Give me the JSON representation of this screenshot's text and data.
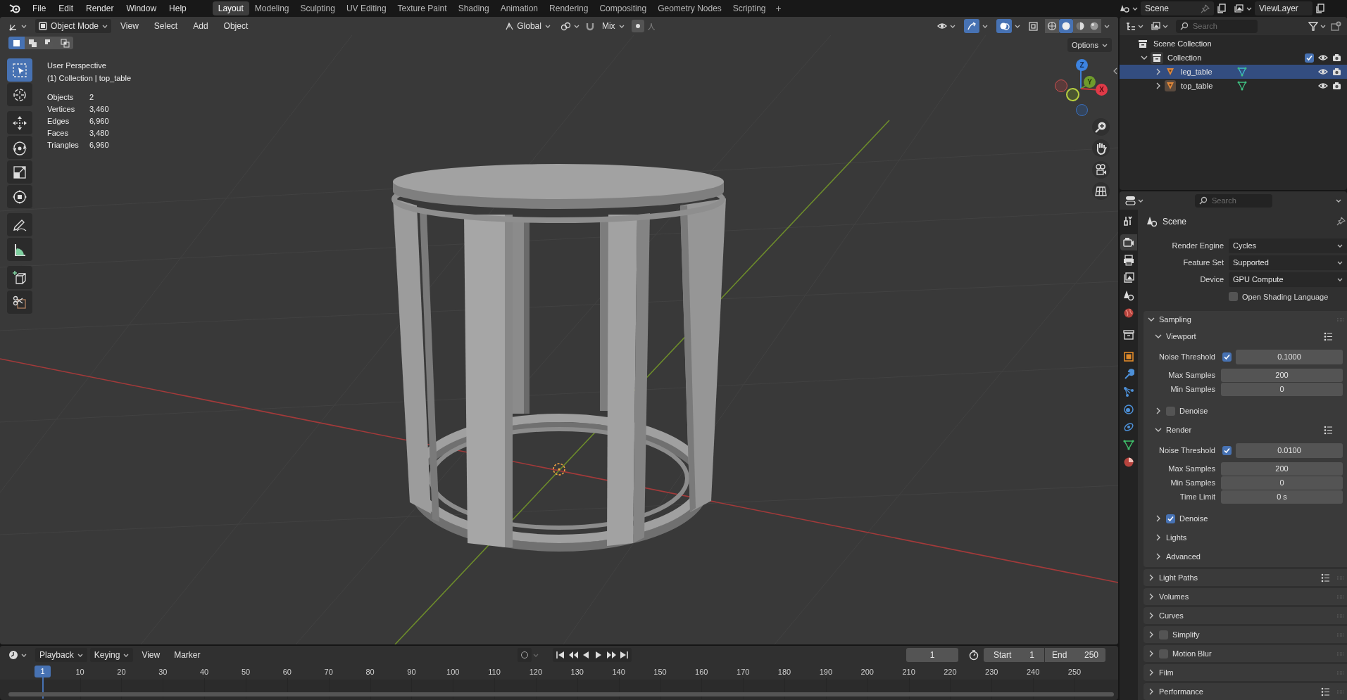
{
  "top_bar": {
    "menus": [
      "File",
      "Edit",
      "Render",
      "Window",
      "Help"
    ],
    "workspaces": [
      {
        "label": "Layout",
        "selected": true
      },
      {
        "label": "Modeling",
        "selected": false
      },
      {
        "label": "Sculpting",
        "selected": false
      },
      {
        "label": "UV Editing",
        "selected": false
      },
      {
        "label": "Texture Paint",
        "selected": false
      },
      {
        "label": "Shading",
        "selected": false
      },
      {
        "label": "Animation",
        "selected": false
      },
      {
        "label": "Rendering",
        "selected": false
      },
      {
        "label": "Compositing",
        "selected": false
      },
      {
        "label": "Geometry Nodes",
        "selected": false
      },
      {
        "label": "Scripting",
        "selected": false
      }
    ],
    "add_workspace": "+",
    "scene": "Scene",
    "view_layer": "ViewLayer"
  },
  "viewport": {
    "mode": "Object Mode",
    "menus": [
      "View",
      "Select",
      "Add",
      "Object"
    ],
    "orientation": "Global",
    "snap_target": "Mix",
    "options": "Options",
    "selection_modes": [
      {
        "kind": "new",
        "selected": true
      },
      {
        "kind": "extend",
        "selected": false
      },
      {
        "kind": "subtract",
        "selected": false
      },
      {
        "kind": "intersect",
        "selected": false
      }
    ],
    "shading_modes": [
      {
        "kind": "wireframe",
        "selected": false
      },
      {
        "kind": "solid",
        "selected": true
      },
      {
        "kind": "material",
        "selected": false
      },
      {
        "kind": "rendered",
        "selected": false
      }
    ],
    "view_name": "User Perspective",
    "context": "(1) Collection | top_table",
    "stats": [
      {
        "label": "Objects",
        "value": "2"
      },
      {
        "label": "Vertices",
        "value": "3,460"
      },
      {
        "label": "Edges",
        "value": "6,960"
      },
      {
        "label": "Faces",
        "value": "3,480"
      },
      {
        "label": "Triangles",
        "value": "6,960"
      }
    ],
    "gizmo_axes": [
      "Z",
      "Y",
      "X"
    ],
    "tools": [
      {
        "kind": "select_box",
        "selected": true
      },
      {
        "kind": "cursor",
        "selected": false
      },
      {
        "kind": "move",
        "selected": false
      },
      {
        "kind": "rotate",
        "selected": false
      },
      {
        "kind": "scale",
        "selected": false
      },
      {
        "kind": "transform",
        "selected": false
      },
      {
        "kind": "annotate",
        "selected": false
      },
      {
        "kind": "measure",
        "selected": false
      },
      {
        "kind": "add_cube",
        "selected": false
      },
      {
        "kind": "shear",
        "selected": false
      }
    ]
  },
  "outliner": {
    "search_placeholder": "Search",
    "tree": [
      {
        "label": "Scene Collection",
        "kind": "scene_collection",
        "selected": false,
        "children": [
          {
            "label": "Collection",
            "kind": "collection",
            "selected": false,
            "expanded": true,
            "checked": true,
            "children": [
              {
                "label": "leg_table",
                "kind": "object",
                "selected": true,
                "expanded": false
              },
              {
                "label": "top_table",
                "kind": "object",
                "selected": false,
                "expanded": false
              }
            ]
          }
        ]
      }
    ]
  },
  "properties": {
    "search_placeholder": "Search",
    "tabs": [
      {
        "kind": "tool",
        "selected": false
      },
      {
        "kind": "render",
        "selected": true
      },
      {
        "kind": "output",
        "selected": false
      },
      {
        "kind": "view_layer",
        "selected": false
      },
      {
        "kind": "scene",
        "selected": false
      },
      {
        "kind": "world",
        "selected": false
      },
      {
        "kind": "collection",
        "selected": false
      },
      {
        "kind": "object",
        "selected": false
      },
      {
        "kind": "modifiers",
        "selected": false
      },
      {
        "kind": "particles",
        "selected": false
      },
      {
        "kind": "physics",
        "selected": false
      },
      {
        "kind": "constraints",
        "selected": false
      },
      {
        "kind": "data",
        "selected": false
      },
      {
        "kind": "material",
        "selected": false
      }
    ],
    "context": "Scene",
    "fields": [
      {
        "label": "Render Engine",
        "value": "Cycles"
      },
      {
        "label": "Feature Set",
        "value": "Supported"
      },
      {
        "label": "Device",
        "value": "GPU Compute"
      }
    ],
    "osl": {
      "label": "Open Shading Language",
      "checked": false
    },
    "panels": [
      {
        "label": "Sampling",
        "expanded": true,
        "children": [
          {
            "label": "Viewport",
            "expanded": true,
            "presets": true,
            "rows": [
              {
                "kind": "check_number",
                "label": "Noise Threshold",
                "checked": true,
                "value": "0.1000"
              },
              {
                "kind": "number",
                "label": "Max Samples",
                "value": "200"
              },
              {
                "kind": "number",
                "label": "Min Samples",
                "value": "0"
              }
            ]
          },
          {
            "label": "Denoise",
            "expanded": false,
            "checked": false
          },
          {
            "label": "Render",
            "expanded": true,
            "presets": true,
            "rows": [
              {
                "kind": "check_number",
                "label": "Noise Threshold",
                "checked": true,
                "value": "0.0100"
              },
              {
                "kind": "number",
                "label": "Max Samples",
                "value": "200"
              },
              {
                "kind": "number",
                "label": "Min Samples",
                "value": "0"
              },
              {
                "kind": "number",
                "label": "Time Limit",
                "value": "0 s"
              }
            ]
          },
          {
            "label": "Denoise",
            "expanded": false,
            "checked": true
          },
          {
            "label": "Lights",
            "expanded": false
          },
          {
            "label": "Advanced",
            "expanded": false
          }
        ]
      },
      {
        "label": "Light Paths",
        "expanded": false,
        "presets": true
      },
      {
        "label": "Volumes",
        "expanded": false
      },
      {
        "label": "Curves",
        "expanded": false
      },
      {
        "label": "Simplify",
        "expanded": false,
        "checked": false
      },
      {
        "label": "Motion Blur",
        "expanded": false,
        "checked": false
      },
      {
        "label": "Film",
        "expanded": false
      },
      {
        "label": "Performance",
        "expanded": false,
        "presets": true
      }
    ]
  },
  "timeline": {
    "menus": [
      "Playback",
      "Keying",
      "View",
      "Marker"
    ],
    "current_frame": "1",
    "start_label": "Start",
    "start": "1",
    "end_label": "End",
    "end": "250",
    "playhead": "1",
    "ruler": [
      "10",
      "20",
      "30",
      "40",
      "50",
      "60",
      "70",
      "80",
      "90",
      "100",
      "110",
      "120",
      "130",
      "140",
      "150",
      "160",
      "170",
      "180",
      "190",
      "200",
      "210",
      "220",
      "230",
      "240",
      "250"
    ]
  }
}
